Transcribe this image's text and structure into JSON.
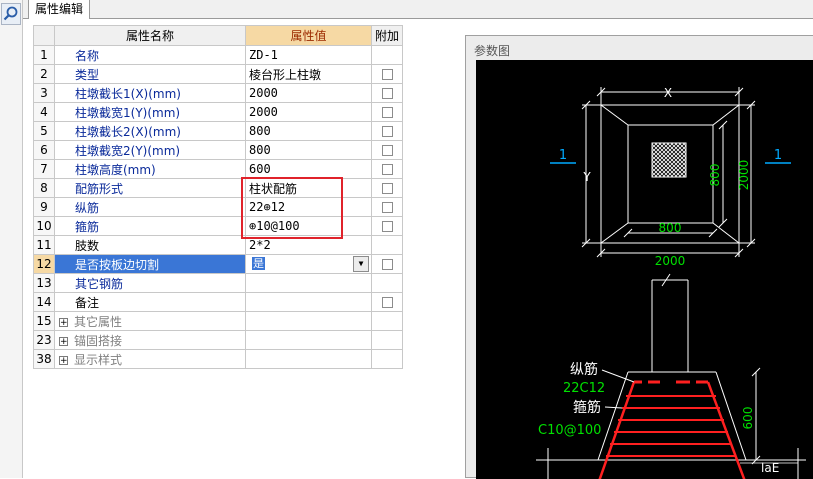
{
  "tab": {
    "label": "属性编辑"
  },
  "grid": {
    "headers": {
      "name": "属性名称",
      "value": "属性值",
      "extra": "附加"
    },
    "rows": [
      {
        "num": "1",
        "name": "名称",
        "value": "ZD-1"
      },
      {
        "num": "2",
        "name": "类型",
        "value": "棱台形上柱墩"
      },
      {
        "num": "3",
        "name": "柱墩截长1(X)(mm)",
        "value": "2000"
      },
      {
        "num": "4",
        "name": "柱墩截宽1(Y)(mm)",
        "value": "2000"
      },
      {
        "num": "5",
        "name": "柱墩截长2(X)(mm)",
        "value": "800"
      },
      {
        "num": "6",
        "name": "柱墩截宽2(Y)(mm)",
        "value": "800"
      },
      {
        "num": "7",
        "name": "柱墩高度(mm)",
        "value": "600"
      },
      {
        "num": "8",
        "name": "配筋形式",
        "value": "柱状配筋"
      },
      {
        "num": "9",
        "name": "纵筋",
        "value": "22⊕12"
      },
      {
        "num": "10",
        "name": "箍筋",
        "value": "⊕10@100"
      },
      {
        "num": "11",
        "name": "肢数",
        "value": "2*2"
      },
      {
        "num": "12",
        "name": "是否按板边切割",
        "value": "是"
      },
      {
        "num": "13",
        "name": "其它钢筋",
        "value": ""
      },
      {
        "num": "14",
        "name": "备注",
        "value": ""
      },
      {
        "num": "15",
        "name": "其它属性",
        "value": ""
      },
      {
        "num": "23",
        "name": "锚固搭接",
        "value": ""
      },
      {
        "num": "38",
        "name": "显示样式",
        "value": ""
      }
    ]
  },
  "panel": {
    "title": "参数图",
    "plan": {
      "x_label": "X",
      "y_label": "Y",
      "inner_w": "800",
      "inner_h": "800",
      "outer_w": "2000",
      "outer_h": "2000",
      "section_mark": "1"
    },
    "section": {
      "long_bar_label": "纵筋",
      "long_bar_value": "22C12",
      "stirrup_label": "箍筋",
      "stirrup_value": "C10@100",
      "height": "600",
      "anchor": "laE"
    }
  },
  "colors": {
    "selection": "#3a76d6",
    "value_header": "#f6d9a4",
    "highlight_box": "#e0232b",
    "drawing_green": "#00e000",
    "rebar_red": "#ff2020"
  }
}
